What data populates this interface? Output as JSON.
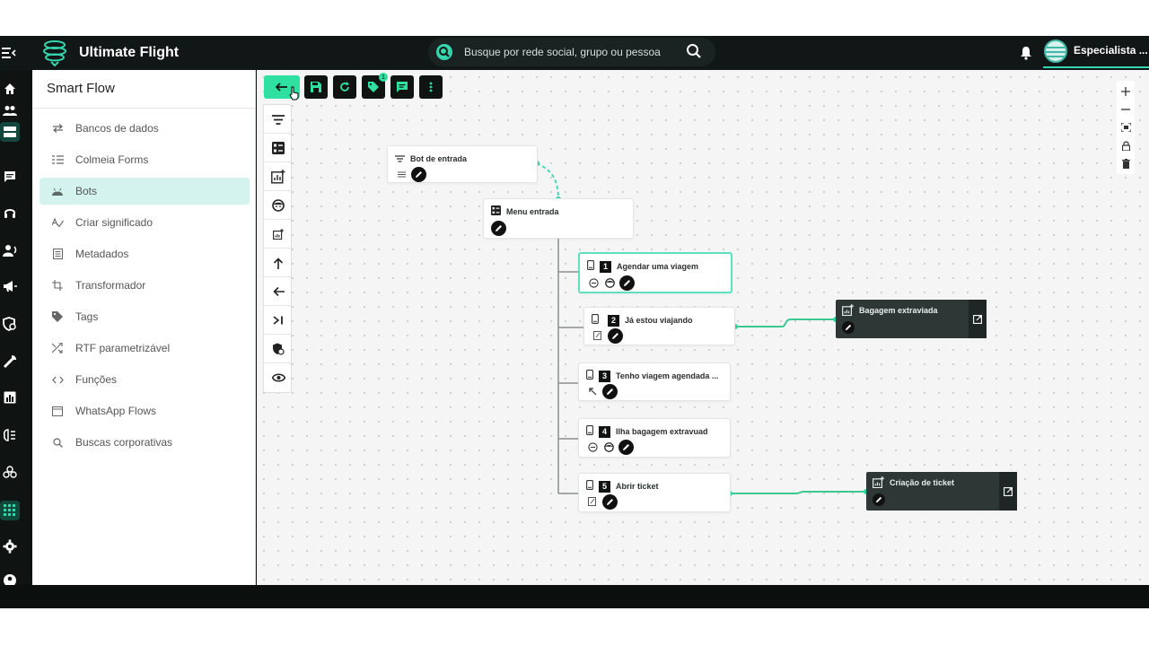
{
  "app": {
    "title": "Ultimate Flight"
  },
  "search": {
    "placeholder": "Busque por rede social, grupo ou pessoa"
  },
  "user": {
    "name": "Especialista ..."
  },
  "sidebar": {
    "title": "Smart Flow",
    "items": [
      {
        "label": "Bancos de dados",
        "icon": "swap-icon"
      },
      {
        "label": "Colmeia Forms",
        "icon": "list-icon"
      },
      {
        "label": "Bots",
        "icon": "android-icon",
        "active": true
      },
      {
        "label": "Criar significado",
        "icon": "spellcheck-icon"
      },
      {
        "label": "Metadados",
        "icon": "document-list-icon"
      },
      {
        "label": "Transformador",
        "icon": "transform-icon"
      },
      {
        "label": "Tags",
        "icon": "tag-icon"
      },
      {
        "label": "RTF parametrizável",
        "icon": "shuffle-icon"
      },
      {
        "label": "Funções",
        "icon": "code-icon"
      },
      {
        "label": "WhatsApp Flows",
        "icon": "window-icon"
      },
      {
        "label": "Buscas corporativas",
        "icon": "search-icon"
      }
    ]
  },
  "toolbar": {
    "badge_count": "1"
  },
  "flow": {
    "entry_bot": {
      "title": "Bot de entrada"
    },
    "menu": {
      "title": "Menu entrada"
    },
    "options": [
      {
        "number": "1",
        "title": "Agendar uma viagem"
      },
      {
        "number": "2",
        "title": "Já estou viajando"
      },
      {
        "number": "3",
        "title": "Tenho viagem agendada ..."
      },
      {
        "number": "4",
        "title": "Ilha bagagem extravuad"
      },
      {
        "number": "5",
        "title": "Abrir ticket"
      }
    ],
    "targets": [
      {
        "title": "Bagagem extraviada"
      },
      {
        "title": "Criação de ticket"
      }
    ]
  },
  "colors": {
    "accent": "#2fe0a0",
    "dark": "#0f1413",
    "selected_border": "#5fe0c0",
    "wire": "#3cc98f"
  }
}
